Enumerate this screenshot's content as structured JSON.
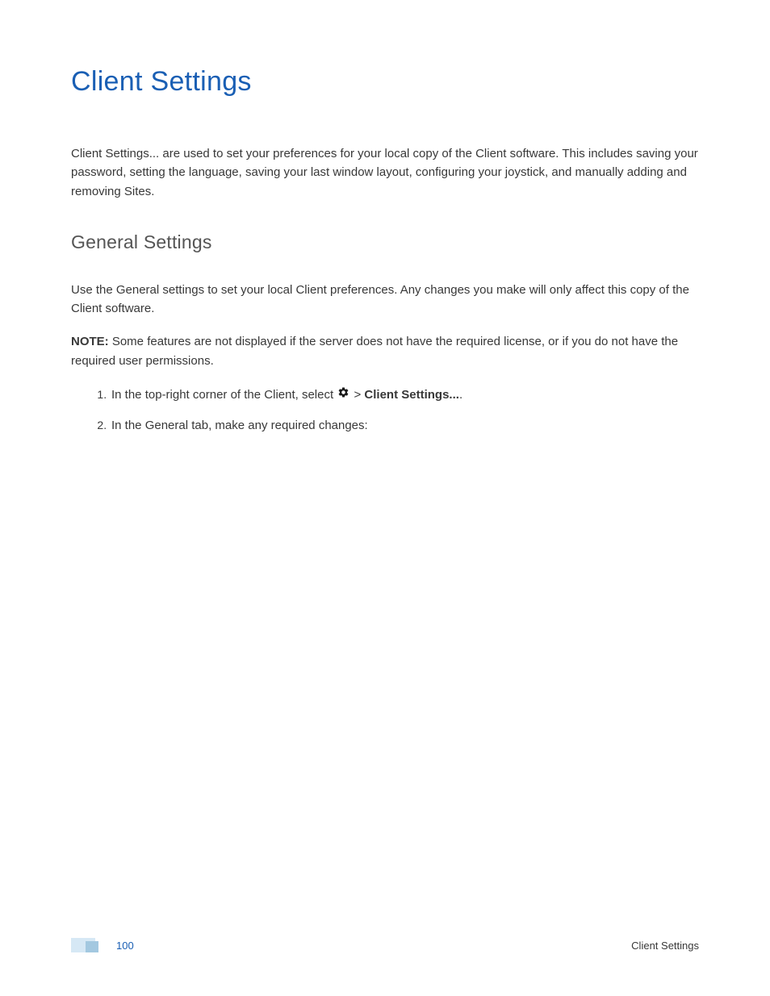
{
  "title": "Client Settings",
  "intro": "Client Settings... are used to set your preferences for your local copy of the Client software. This includes saving your password, setting the language, saving your last window layout, configuring your joystick, and manually adding and removing Sites.",
  "section_heading": "General Settings",
  "section_intro": "Use the General settings to set your local Client preferences. Any changes you make will only affect this copy of the Client software.",
  "note_label": "NOTE:",
  "note_text": " Some features are not displayed if the server does not have the required license, or if you do not have the required user permissions.",
  "step1_prefix": "In the top-right corner of the Client, select ",
  "step1_gt": " > ",
  "step1_bold": "Client Settings...",
  "step1_suffix": ".",
  "step2": "In the General tab, make any required changes:",
  "footer": {
    "page_number": "100",
    "section_name": "Client Settings"
  }
}
